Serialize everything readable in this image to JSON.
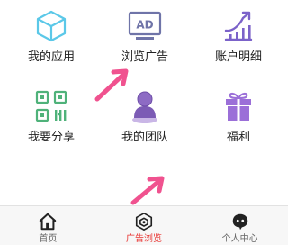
{
  "menu": {
    "items": [
      {
        "label": "我的应用",
        "icon": "cube-icon"
      },
      {
        "label": "浏览广告",
        "icon": "ad-monitor-icon"
      },
      {
        "label": "账户明细",
        "icon": "growth-chart-icon"
      },
      {
        "label": "我要分享",
        "icon": "qr-code-icon"
      },
      {
        "label": "我的团队",
        "icon": "team-icon"
      },
      {
        "label": "福利",
        "icon": "gift-icon"
      }
    ]
  },
  "ad_icon_text": "AD",
  "tabbar": {
    "tabs": [
      {
        "label": "首页",
        "icon": "home-icon"
      },
      {
        "label": "广告浏览",
        "icon": "ad-browse-icon",
        "active": true
      },
      {
        "label": "个人中心",
        "icon": "profile-icon"
      }
    ]
  },
  "colors": {
    "cube": "#5bc8e8",
    "ad_monitor": "#6f74a8",
    "growth_chart": "#7b62c9",
    "qr_code": "#4fb27a",
    "team": "#7c5bb5",
    "gift": "#9b6fd8",
    "arrow": "#f0528f",
    "active_tab": "#e8322f",
    "tab_icon": "#222222"
  }
}
